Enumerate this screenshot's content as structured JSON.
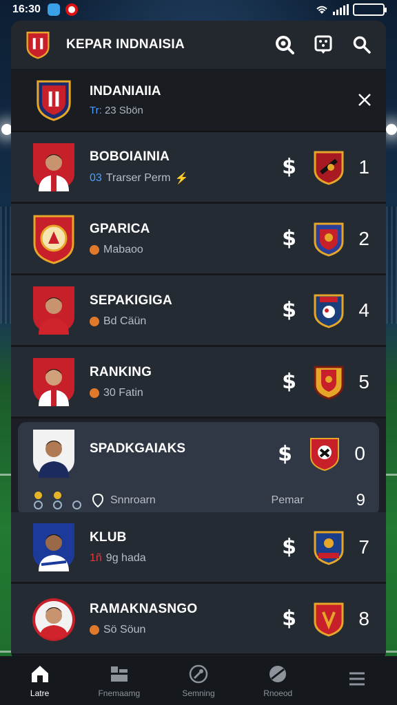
{
  "status_bar": {
    "time": "16:30"
  },
  "app_bar": {
    "title": "KEPAR INDNAISIA"
  },
  "team_header": {
    "name": "INDANIAIIA",
    "sub_prefix": "Tr:",
    "sub_text": "23 Sbön"
  },
  "rows": [
    {
      "name": "BOBOIAINIA",
      "sub_prefix": "03",
      "sub_text": "Trarser Perm",
      "rank": "1"
    },
    {
      "name": "GPARICA",
      "sub_text": "Mabaoo",
      "rank": "2"
    },
    {
      "name": "SEPAKIGIGA",
      "sub_text": "Bd Cäün",
      "rank": "4"
    },
    {
      "name": "RANKING",
      "sub_text": "30 Fatin",
      "rank": "5"
    },
    {
      "name": "KLUB",
      "sub_prefix": "1ñ",
      "sub_text": "9g hada",
      "rank": "7"
    },
    {
      "name": "RAMAKNASNGO",
      "sub_text": "Sö Söun",
      "rank": "8"
    }
  ],
  "highlight": {
    "name": "SPADKGAIAKS",
    "rank": "0",
    "left_label": "Snnroarn",
    "right_label": "Pemar",
    "right_value": "9"
  },
  "tabs": [
    {
      "label": "Latre",
      "icon": "home-icon"
    },
    {
      "label": "Fnemaamg",
      "icon": "stats-icon"
    },
    {
      "label": "Semning",
      "icon": "search-ball-icon"
    },
    {
      "label": "Rnoeod",
      "icon": "ball-icon"
    },
    {
      "label": "",
      "icon": "menu-icon"
    }
  ],
  "colors": {
    "panel": "#1c2026",
    "row": "#252b33",
    "highlight": "#2f3844",
    "accent_red": "#c8202a",
    "accent_gold": "#e6a628"
  }
}
